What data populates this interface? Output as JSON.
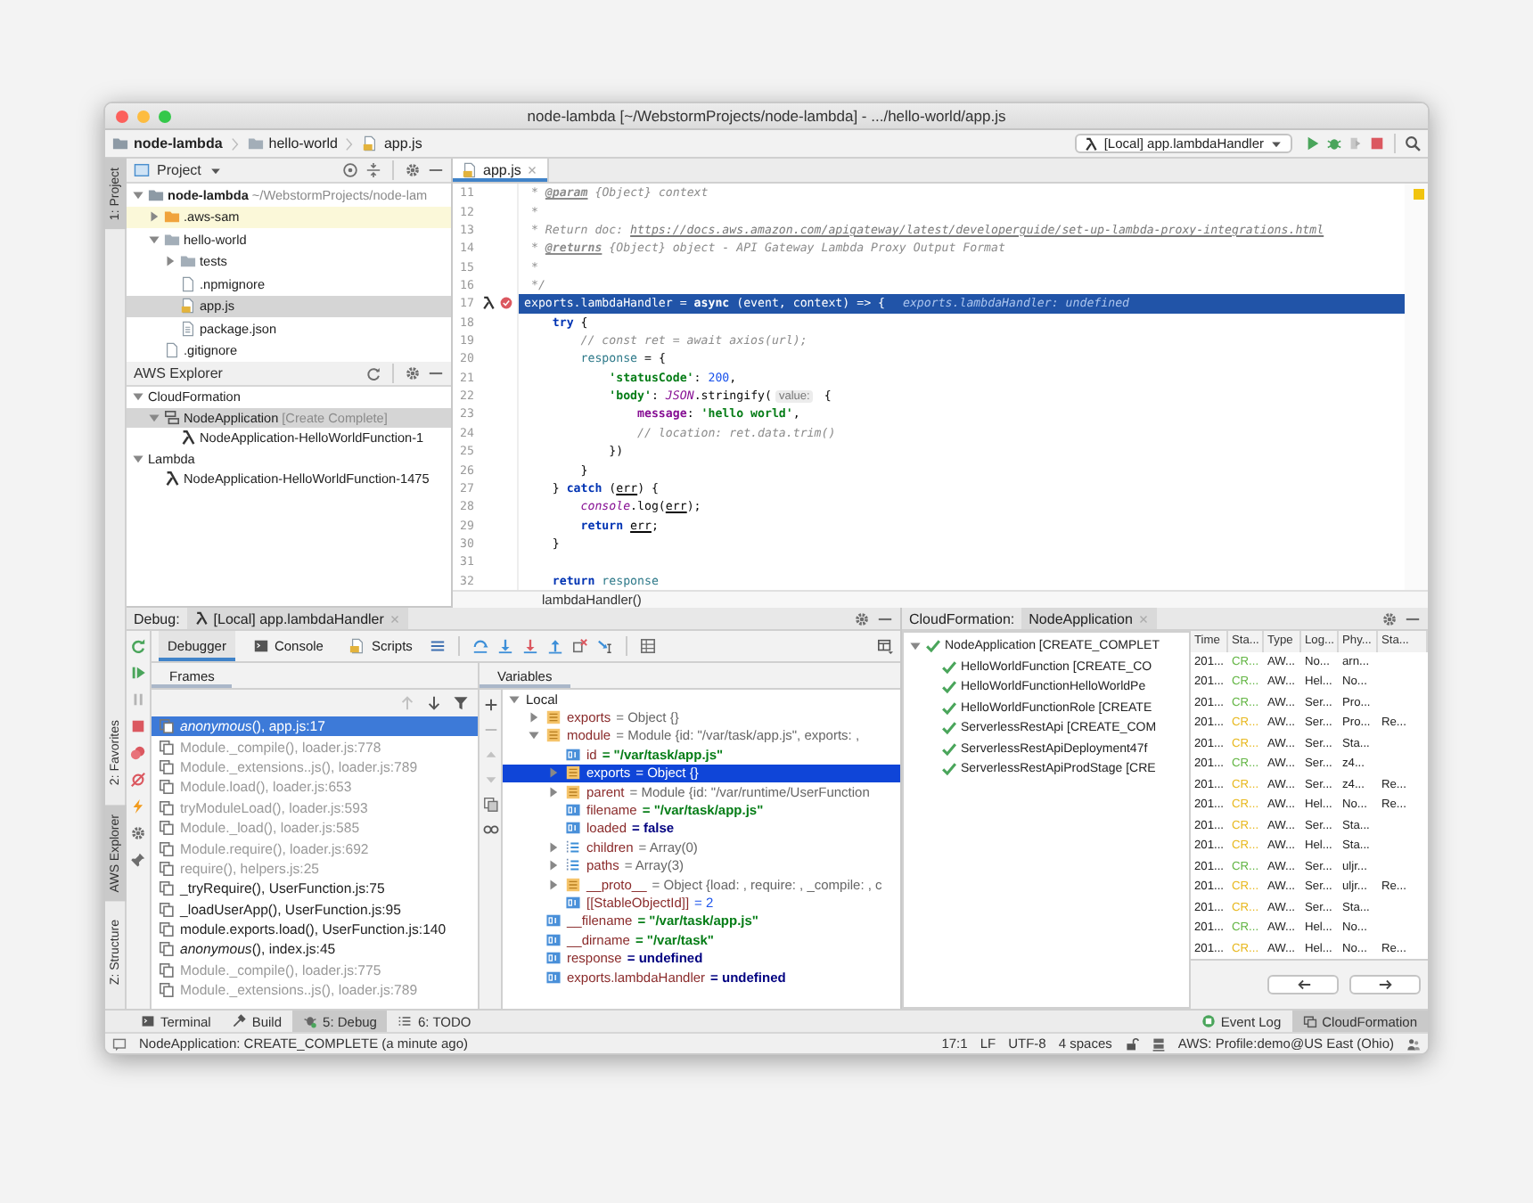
{
  "window": {
    "title": "node-lambda [~/WebstormProjects/node-lambda] - .../hello-world/app.js"
  },
  "navigation": {
    "breadcrumbs": [
      {
        "label": "node-lambda",
        "kind": "project"
      },
      {
        "label": "hello-world",
        "kind": "folder"
      },
      {
        "label": "app.js",
        "kind": "js"
      }
    ],
    "run_config": "[Local] app.lambdaHandler"
  },
  "left_strip": [
    {
      "label": "1: Project",
      "selected": true
    },
    {
      "label": "2: Favorites",
      "selected": false
    },
    {
      "label": "AWS Explorer",
      "selected": true
    },
    {
      "label": "Z: Structure",
      "selected": false
    }
  ],
  "project_panel": {
    "title": "Project",
    "tree": [
      {
        "label": "node-lambda",
        "note": "~/WebstormProjects/node-lam",
        "kind": "project",
        "expanded": true,
        "selected": false,
        "highlighted": false,
        "children": [
          {
            "label": ".aws-sam",
            "kind": "special-folder",
            "expanded": false,
            "selected": false,
            "highlighted": true
          },
          {
            "label": "hello-world",
            "kind": "folder",
            "expanded": true,
            "selected": false,
            "highlighted": false,
            "children": [
              {
                "label": "tests",
                "kind": "folder",
                "expanded": false,
                "selected": false,
                "highlighted": false
              },
              {
                "label": ".npmignore",
                "kind": "file",
                "selected": false,
                "highlighted": false
              },
              {
                "label": "app.js",
                "kind": "js",
                "selected": true,
                "highlighted": false
              },
              {
                "label": "package.json",
                "kind": "json",
                "selected": false,
                "highlighted": false
              }
            ]
          },
          {
            "label": ".gitignore",
            "kind": "file",
            "selected": false,
            "highlighted": false
          }
        ]
      }
    ]
  },
  "aws_explorer": {
    "title": "AWS Explorer",
    "tree": [
      {
        "label": "CloudFormation",
        "expanded": true,
        "selected": false,
        "children": [
          {
            "label": "NodeApplication",
            "note": "[Create Complete]",
            "kind": "stack",
            "expanded": true,
            "selected": true,
            "children": [
              {
                "label": "NodeApplication-HelloWorldFunction-1",
                "kind": "lambda",
                "selected": false
              }
            ]
          }
        ]
      },
      {
        "label": "Lambda",
        "expanded": true,
        "selected": false,
        "children": [
          {
            "label": "NodeApplication-HelloWorldFunction-1475",
            "kind": "lambda",
            "selected": false
          }
        ]
      }
    ]
  },
  "editor": {
    "tabs": [
      {
        "label": "app.js",
        "selected": true
      }
    ],
    "lines": [
      {
        "number": "11",
        "kind": "code",
        "tokens": [
          {
            "kind": "comment",
            "text": " * "
          },
          {
            "kind": "doc-tag",
            "text": "@param"
          },
          {
            "kind": "comment",
            "text": " {Object} context"
          }
        ]
      },
      {
        "number": "12",
        "kind": "code",
        "tokens": [
          {
            "kind": "comment",
            "text": " *"
          }
        ]
      },
      {
        "number": "13",
        "kind": "code",
        "tokens": [
          {
            "kind": "comment",
            "text": " * Return doc: "
          },
          {
            "kind": "link",
            "text": "https://docs.aws.amazon.com/apigateway/latest/developerguide/set-up-lambda-proxy-integrations.html"
          }
        ]
      },
      {
        "number": "14",
        "kind": "code",
        "tokens": [
          {
            "kind": "comment",
            "text": " * "
          },
          {
            "kind": "doc-tag",
            "text": "@returns"
          },
          {
            "kind": "comment",
            "text": " {Object} object - API Gateway Lambda Proxy Output Format"
          }
        ]
      },
      {
        "number": "15",
        "kind": "code",
        "tokens": [
          {
            "kind": "comment",
            "text": " *"
          }
        ]
      },
      {
        "number": "16",
        "kind": "code",
        "tokens": [
          {
            "kind": "comment",
            "text": " */"
          }
        ]
      },
      {
        "number": "17",
        "kind": "execution-point",
        "tokens": [
          {
            "kind": "code",
            "text": "exports.lambdaHandler = "
          },
          {
            "kind": "keyword",
            "text": "async"
          },
          {
            "kind": "code",
            "text": " (event, context) => {"
          },
          {
            "kind": "hint",
            "text": "exports.lambdaHandler: undefined"
          }
        ]
      },
      {
        "number": "18",
        "kind": "code",
        "tokens": [
          {
            "kind": "keyword",
            "text": "    try"
          },
          {
            "kind": "code",
            "text": " {"
          }
        ]
      },
      {
        "number": "19",
        "kind": "code",
        "tokens": [
          {
            "kind": "comment",
            "text": "        // const ret = await axios(url);"
          }
        ]
      },
      {
        "number": "20",
        "kind": "code",
        "tokens": [
          {
            "kind": "variable",
            "text": "        response"
          },
          {
            "kind": "code",
            "text": " = {"
          }
        ]
      },
      {
        "number": "21",
        "kind": "code",
        "tokens": [
          {
            "kind": "string",
            "text": "            'statusCode'"
          },
          {
            "kind": "code",
            "text": ": "
          },
          {
            "kind": "number",
            "text": "200"
          },
          {
            "kind": "code",
            "text": ","
          }
        ]
      },
      {
        "number": "22",
        "kind": "code",
        "tokens": [
          {
            "kind": "string",
            "text": "            'body'"
          },
          {
            "kind": "code",
            "text": ": "
          },
          {
            "kind": "global",
            "text": "JSON"
          },
          {
            "kind": "code",
            "text": ".stringify("
          },
          {
            "kind": "param-hint",
            "text": "value:"
          },
          {
            "kind": "code",
            "text": " {"
          }
        ]
      },
      {
        "number": "23",
        "kind": "code",
        "tokens": [
          {
            "kind": "field",
            "text": "                message"
          },
          {
            "kind": "code",
            "text": ": "
          },
          {
            "kind": "string",
            "text": "'hello world'"
          },
          {
            "kind": "code",
            "text": ","
          }
        ]
      },
      {
        "number": "24",
        "kind": "code",
        "tokens": [
          {
            "kind": "comment",
            "text": "                // location: ret.data.trim()"
          }
        ]
      },
      {
        "number": "25",
        "kind": "code",
        "tokens": [
          {
            "kind": "code",
            "text": "            })"
          }
        ]
      },
      {
        "number": "26",
        "kind": "code",
        "tokens": [
          {
            "kind": "code",
            "text": "        }"
          }
        ]
      },
      {
        "number": "27",
        "kind": "code",
        "tokens": [
          {
            "kind": "code",
            "text": "    } "
          },
          {
            "kind": "keyword",
            "text": "catch"
          },
          {
            "kind": "code",
            "text": " ("
          },
          {
            "kind": "param",
            "text": "err"
          },
          {
            "kind": "code",
            "text": ") {"
          }
        ]
      },
      {
        "number": "28",
        "kind": "code",
        "tokens": [
          {
            "kind": "global",
            "text": "        console"
          },
          {
            "kind": "code",
            "text": ".log("
          },
          {
            "kind": "param",
            "text": "err"
          },
          {
            "kind": "code",
            "text": ");"
          }
        ]
      },
      {
        "number": "29",
        "kind": "code",
        "tokens": [
          {
            "kind": "keyword",
            "text": "        return "
          },
          {
            "kind": "param",
            "text": "err"
          },
          {
            "kind": "code",
            "text": ";"
          }
        ]
      },
      {
        "number": "30",
        "kind": "code",
        "tokens": [
          {
            "kind": "code",
            "text": "    }"
          }
        ]
      },
      {
        "number": "31",
        "kind": "code"
      },
      {
        "number": "32",
        "kind": "code",
        "tokens": [
          {
            "kind": "keyword",
            "text": "    return "
          },
          {
            "kind": "variable",
            "text": "response"
          }
        ]
      }
    ],
    "breadcrumb": "lambdaHandler()"
  },
  "debug": {
    "label": "Debug:",
    "session": "[Local] app.lambdaHandler",
    "tabs": [
      {
        "label": "Debugger",
        "selected": true
      },
      {
        "label": "Console",
        "selected": false
      },
      {
        "label": "Scripts",
        "selected": false
      }
    ],
    "frames_title": "Frames",
    "frames": [
      {
        "label": "*anonymous*(), app.js:17",
        "selected": true,
        "dimmed": false
      },
      {
        "label": "Module._compile(), loader.js:778",
        "selected": false,
        "dimmed": true
      },
      {
        "label": "Module._extensions..js(), loader.js:789",
        "selected": false,
        "dimmed": true
      },
      {
        "label": "Module.load(), loader.js:653",
        "selected": false,
        "dimmed": true
      },
      {
        "label": "tryModuleLoad(), loader.js:593",
        "selected": false,
        "dimmed": true
      },
      {
        "label": "Module._load(), loader.js:585",
        "selected": false,
        "dimmed": true
      },
      {
        "label": "Module.require(), loader.js:692",
        "selected": false,
        "dimmed": true
      },
      {
        "label": "require(), helpers.js:25",
        "selected": false,
        "dimmed": true
      },
      {
        "label": "_tryRequire(), UserFunction.js:75",
        "selected": false,
        "dimmed": false
      },
      {
        "label": "_loadUserApp(), UserFunction.js:95",
        "selected": false,
        "dimmed": false
      },
      {
        "label": "module.exports.load(), UserFunction.js:140",
        "selected": false,
        "dimmed": false
      },
      {
        "label": "*anonymous*(), index.js:45",
        "selected": false,
        "dimmed": false
      },
      {
        "label": "Module._compile(), loader.js:775",
        "selected": false,
        "dimmed": true
      },
      {
        "label": "Module._extensions..js(), loader.js:789",
        "selected": false,
        "dimmed": true
      }
    ],
    "variables_title": "Variables",
    "variables": [
      {
        "name": "Local",
        "kind": "scope",
        "expanded": true,
        "selected": false,
        "children": [
          {
            "name": "exports",
            "value": {
              "text": "= Object {}",
              "kind": "object"
            },
            "kind": "object",
            "expanded": false,
            "selected": false
          },
          {
            "name": "module",
            "value": {
              "text": "= Module {id: \"/var/task/app.js\", exports: ,",
              "kind": "object"
            },
            "kind": "object",
            "expanded": true,
            "selected": false,
            "children": [
              {
                "name": "id",
                "value": {
                  "text": "= \"/var/task/app.js\"",
                  "kind": "string"
                },
                "kind": "primitive",
                "selected": false
              },
              {
                "name": "exports",
                "value": {
                  "text": "= Object {}",
                  "kind": "object"
                },
                "kind": "object",
                "expanded": false,
                "selected": true
              },
              {
                "name": "parent",
                "value": {
                  "text": "= Module {id: \"/var/runtime/UserFunction",
                  "kind": "object"
                },
                "kind": "object",
                "expanded": false,
                "selected": false
              },
              {
                "name": "filename",
                "value": {
                  "text": "= \"/var/task/app.js\"",
                  "kind": "string"
                },
                "kind": "primitive",
                "selected": false
              },
              {
                "name": "loaded",
                "value": {
                  "text": "= false",
                  "kind": "keyword"
                },
                "kind": "primitive",
                "selected": false
              },
              {
                "name": "children",
                "value": {
                  "text": "= Array(0)",
                  "kind": "object"
                },
                "kind": "array",
                "expanded": false,
                "selected": false
              },
              {
                "name": "paths",
                "value": {
                  "text": "= Array(3)",
                  "kind": "object"
                },
                "kind": "array",
                "expanded": false,
                "selected": false
              },
              {
                "name": "__proto__",
                "value": {
                  "text": "= Object {load: , require: , _compile: , c",
                  "kind": "object"
                },
                "kind": "object",
                "expanded": false,
                "selected": false
              },
              {
                "name": "[[StableObjectId]]",
                "value": {
                  "text": "= 2",
                  "kind": "number"
                },
                "kind": "primitive",
                "selected": false
              }
            ]
          },
          {
            "name": "__filename",
            "value": {
              "text": "= \"/var/task/app.js\"",
              "kind": "string"
            },
            "kind": "primitive",
            "selected": false
          },
          {
            "name": "__dirname",
            "value": {
              "text": "= \"/var/task\"",
              "kind": "string"
            },
            "kind": "primitive",
            "selected": false
          },
          {
            "name": "response",
            "value": {
              "text": "= undefined",
              "kind": "keyword"
            },
            "kind": "primitive",
            "selected": false
          },
          {
            "name": "exports.lambdaHandler",
            "value": {
              "text": "= undefined",
              "kind": "keyword"
            },
            "kind": "primitive",
            "selected": false
          }
        ]
      }
    ]
  },
  "cloudformation": {
    "label": "CloudFormation:",
    "tab": "NodeApplication",
    "tree": [
      {
        "label": "NodeApplication [CREATE_COMPLET",
        "kind": "complete",
        "expanded": true,
        "selected": false,
        "children": [
          {
            "label": "HelloWorldFunction [CREATE_CO",
            "kind": "complete",
            "selected": false
          },
          {
            "label": "HelloWorldFunctionHelloWorldPe",
            "kind": "complete",
            "selected": false
          },
          {
            "label": "HelloWorldFunctionRole [CREATE",
            "kind": "complete",
            "selected": false
          },
          {
            "label": "ServerlessRestApi [CREATE_COM",
            "kind": "complete",
            "selected": false
          },
          {
            "label": "ServerlessRestApiDeployment47f",
            "kind": "complete",
            "selected": false
          },
          {
            "label": "ServerlessRestApiProdStage [CRE",
            "kind": "complete",
            "selected": false
          }
        ]
      }
    ],
    "table": {
      "columns": [
        "Time",
        "Sta...",
        "Type",
        "Log...",
        "Phy...",
        "Sta..."
      ],
      "rows": [
        {
          "time": "201...",
          "status": {
            "text": "CR...",
            "color": "#62b543"
          },
          "type": "AW...",
          "logical": "No...",
          "physical": "arn..."
        },
        {
          "time": "201...",
          "status": {
            "text": "CR...",
            "color": "#62b543"
          },
          "type": "AW...",
          "logical": "Hel...",
          "physical": "No..."
        },
        {
          "time": "201...",
          "status": {
            "text": "CR...",
            "color": "#62b543"
          },
          "type": "AW...",
          "logical": "Ser...",
          "physical": "Pro..."
        },
        {
          "time": "201...",
          "status": {
            "text": "CR...",
            "color": "#e8b81e"
          },
          "type": "AW...",
          "logical": "Ser...",
          "physical": "Pro...",
          "column_6": "Re..."
        },
        {
          "time": "201...",
          "status": {
            "text": "CR...",
            "color": "#e8b81e"
          },
          "type": "AW...",
          "logical": "Ser...",
          "physical": "Sta..."
        },
        {
          "time": "201...",
          "status": {
            "text": "CR...",
            "color": "#62b543"
          },
          "type": "AW...",
          "logical": "Ser...",
          "physical": "z4..."
        },
        {
          "time": "201...",
          "status": {
            "text": "CR...",
            "color": "#e8b81e"
          },
          "type": "AW...",
          "logical": "Ser...",
          "physical": "z4...",
          "column_6": "Re..."
        },
        {
          "time": "201...",
          "status": {
            "text": "CR...",
            "color": "#e8b81e"
          },
          "type": "AW...",
          "logical": "Hel...",
          "physical": "No...",
          "column_6": "Re..."
        },
        {
          "time": "201...",
          "status": {
            "text": "CR...",
            "color": "#e8b81e"
          },
          "type": "AW...",
          "logical": "Ser...",
          "physical": "Sta..."
        },
        {
          "time": "201...",
          "status": {
            "text": "CR...",
            "color": "#e8b81e"
          },
          "type": "AW...",
          "logical": "Hel...",
          "physical": "Sta..."
        },
        {
          "time": "201...",
          "status": {
            "text": "CR...",
            "color": "#62b543"
          },
          "type": "AW...",
          "logical": "Ser...",
          "physical": "uljr..."
        },
        {
          "time": "201...",
          "status": {
            "text": "CR...",
            "color": "#e8b81e"
          },
          "type": "AW...",
          "logical": "Ser...",
          "physical": "uljr...",
          "column_6": "Re..."
        },
        {
          "time": "201...",
          "status": {
            "text": "CR...",
            "color": "#e8b81e"
          },
          "type": "AW...",
          "logical": "Ser...",
          "physical": "Sta..."
        },
        {
          "time": "201...",
          "status": {
            "text": "CR...",
            "color": "#62b543"
          },
          "type": "AW...",
          "logical": "Hel...",
          "physical": "No..."
        },
        {
          "time": "201...",
          "status": {
            "text": "CR...",
            "color": "#e8b81e"
          },
          "type": "AW...",
          "logical": "Hel...",
          "physical": "No...",
          "column_6": "Re..."
        }
      ]
    }
  },
  "tool_buttons": {
    "left": [
      {
        "label": "Terminal",
        "kind": "terminal",
        "selected": false
      },
      {
        "label": "Build",
        "kind": "build",
        "selected": false
      },
      {
        "label": "5: Debug",
        "kind": "debug",
        "selected": true
      },
      {
        "label": "6: TODO",
        "kind": "todo",
        "selected": false
      }
    ],
    "right": [
      {
        "label": "Event Log",
        "kind": "event-log",
        "selected": false
      },
      {
        "label": "CloudFormation",
        "kind": "cloudformation",
        "selected": true
      }
    ]
  },
  "status_bar": {
    "message": "NodeApplication: CREATE_COMPLETE (a minute ago)",
    "items": [
      "17:1",
      "LF",
      "UTF-8",
      "4 spaces"
    ],
    "profile": "AWS: Profile:demo@US East (Ohio)"
  }
}
